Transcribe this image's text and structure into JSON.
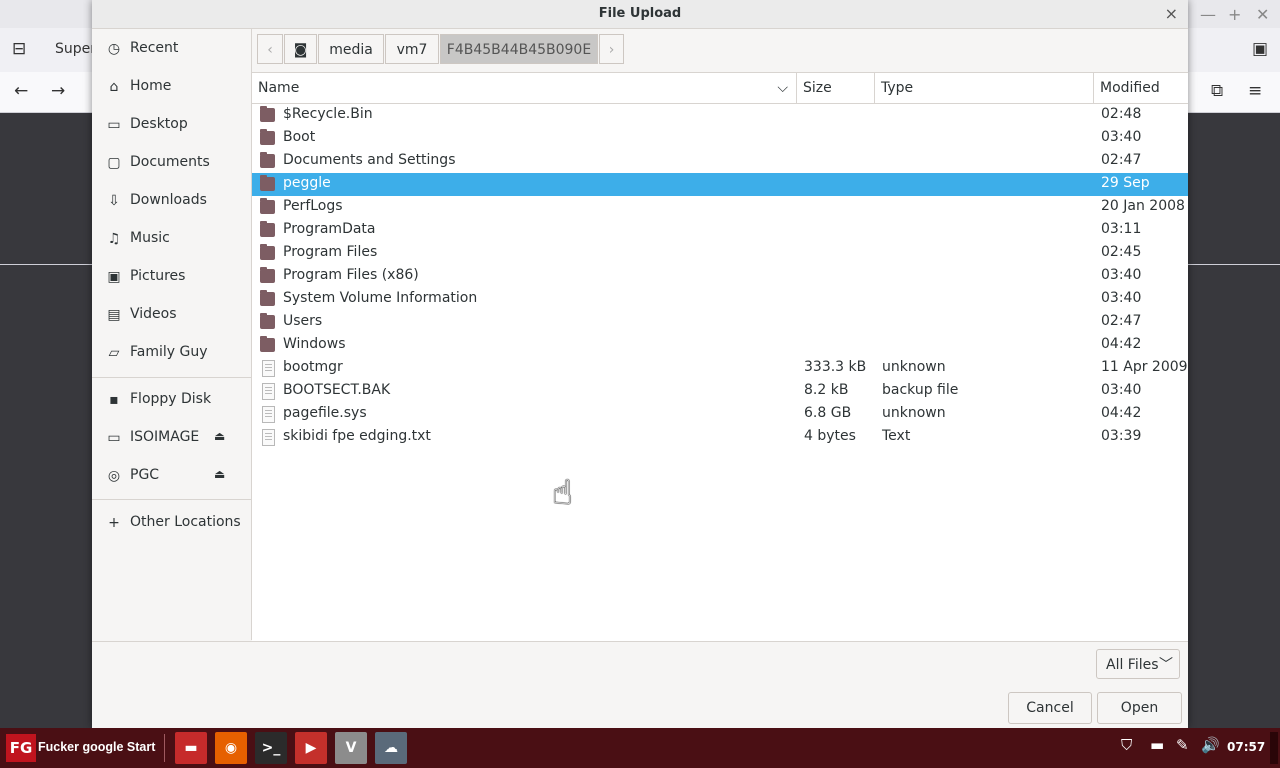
{
  "background": {
    "tab_title": "Super"
  },
  "dialog": {
    "title": "File Upload",
    "close_glyph": "×"
  },
  "sidebar": {
    "items": [
      {
        "label": "Recent",
        "icon": "clock-icon"
      },
      {
        "label": "Home",
        "icon": "home-icon"
      },
      {
        "label": "Desktop",
        "icon": "desktop-icon"
      },
      {
        "label": "Documents",
        "icon": "documents-icon"
      },
      {
        "label": "Downloads",
        "icon": "downloads-icon"
      },
      {
        "label": "Music",
        "icon": "music-icon"
      },
      {
        "label": "Pictures",
        "icon": "pictures-icon"
      },
      {
        "label": "Videos",
        "icon": "videos-icon"
      },
      {
        "label": "Family Guy",
        "icon": "folder-icon"
      }
    ],
    "devices": [
      {
        "label": "Floppy Disk",
        "icon": "floppy-icon"
      },
      {
        "label": "ISOIMAGE",
        "icon": "drive-icon",
        "ejectable": true
      },
      {
        "label": "PGC",
        "icon": "disc-icon",
        "ejectable": true
      }
    ],
    "other_locations": "Other Locations"
  },
  "pathbar": {
    "segments": [
      "media",
      "vm7",
      "F4B45B44B45B090E"
    ],
    "active": "F4B45B44B45B090E"
  },
  "columns": {
    "name": "Name",
    "size": "Size",
    "type": "Type",
    "modified": "Modified"
  },
  "files": [
    {
      "name": "$Recycle.Bin",
      "size": "",
      "type": "",
      "modified": "02:48",
      "kind": "folder"
    },
    {
      "name": "Boot",
      "size": "",
      "type": "",
      "modified": "03:40",
      "kind": "folder"
    },
    {
      "name": "Documents and Settings",
      "size": "",
      "type": "",
      "modified": "02:47",
      "kind": "folder"
    },
    {
      "name": "peggle",
      "size": "",
      "type": "",
      "modified": "29 Sep",
      "kind": "folder",
      "selected": true
    },
    {
      "name": "PerfLogs",
      "size": "",
      "type": "",
      "modified": "20 Jan 2008",
      "kind": "folder"
    },
    {
      "name": "ProgramData",
      "size": "",
      "type": "",
      "modified": "03:11",
      "kind": "folder"
    },
    {
      "name": "Program Files",
      "size": "",
      "type": "",
      "modified": "02:45",
      "kind": "folder"
    },
    {
      "name": "Program Files (x86)",
      "size": "",
      "type": "",
      "modified": "03:40",
      "kind": "folder"
    },
    {
      "name": "System Volume Information",
      "size": "",
      "type": "",
      "modified": "03:40",
      "kind": "folder"
    },
    {
      "name": "Users",
      "size": "",
      "type": "",
      "modified": "02:47",
      "kind": "folder"
    },
    {
      "name": "Windows",
      "size": "",
      "type": "",
      "modified": "04:42",
      "kind": "folder"
    },
    {
      "name": "bootmgr",
      "size": "333.3 kB",
      "type": "unknown",
      "modified": "11 Apr 2009",
      "kind": "file"
    },
    {
      "name": "BOOTSECT.BAK",
      "size": "8.2 kB",
      "type": "backup file",
      "modified": "03:40",
      "kind": "file"
    },
    {
      "name": "pagefile.sys",
      "size": "6.8 GB",
      "type": "unknown",
      "modified": "04:42",
      "kind": "file"
    },
    {
      "name": "skibidi fpe edging.txt",
      "size": "4 bytes",
      "type": "Text",
      "modified": "03:39",
      "kind": "text"
    }
  ],
  "footer": {
    "filter_label": "All Files",
    "cancel_label": "Cancel",
    "open_label": "Open"
  },
  "taskbar": {
    "start_logo": "FG",
    "start_label": "Fucker google Start",
    "apps": [
      {
        "name": "file-manager-icon",
        "color": "#c62b2b"
      },
      {
        "name": "firefox-icon",
        "color": "#e66000"
      },
      {
        "name": "terminal-icon",
        "color": "#2b2b2b"
      },
      {
        "name": "youtube-icon",
        "color": "#c4302b"
      },
      {
        "name": "vivaldi-icon",
        "color": "#8c8c8c"
      },
      {
        "name": "cloud-icon",
        "color": "#5a6a7a"
      }
    ],
    "clock": "07:57"
  },
  "colors": {
    "selection": "#3daee9",
    "folder": "#7d5d63",
    "taskbar": "#4a0f14"
  }
}
